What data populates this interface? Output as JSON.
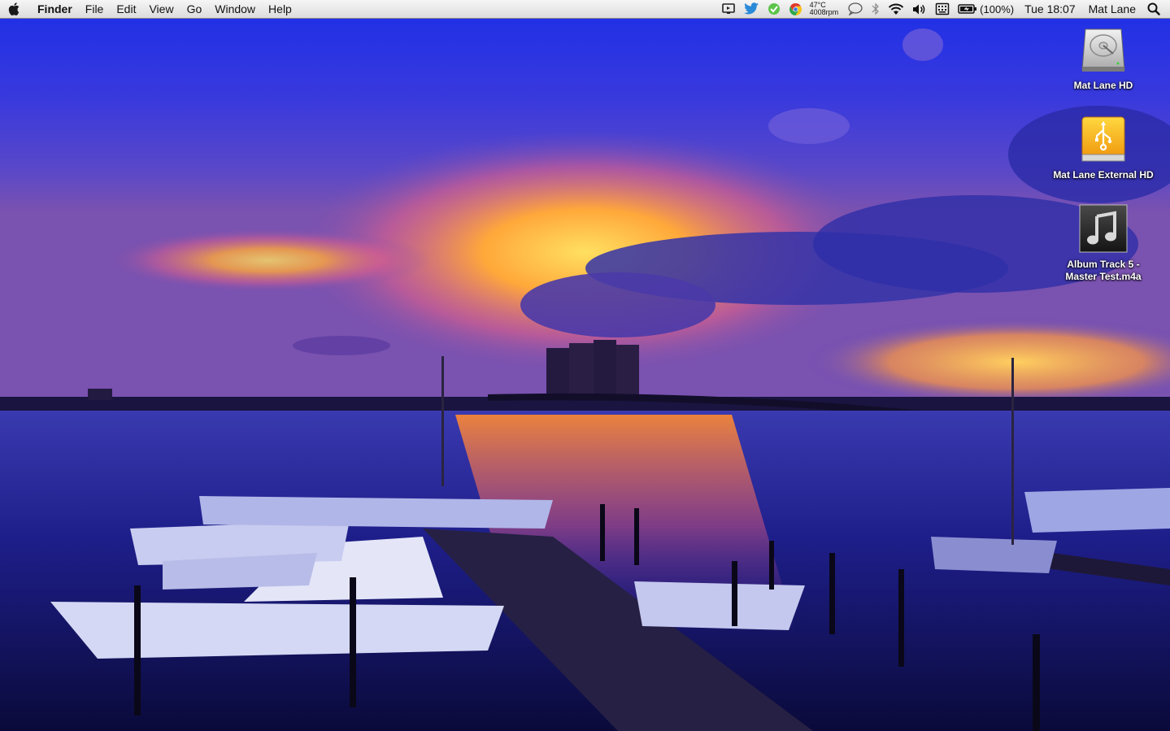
{
  "menubar": {
    "apple_icon": "apple-logo-icon",
    "app_name": "Finder",
    "menus": [
      "File",
      "Edit",
      "View",
      "Go",
      "Window",
      "Help"
    ],
    "status": {
      "temperature": "47°C",
      "fan_speed": "4008rpm",
      "battery_percent": "(100%)",
      "clock": "Tue 18:07",
      "user": "Mat Lane"
    },
    "tray_icons": [
      "display-icon",
      "twitter-bird-icon",
      "evernote-icon",
      "chrome-icon",
      "temperature-monitor",
      "speech-bubble-icon",
      "bluetooth-icon",
      "wifi-icon",
      "volume-icon",
      "keyboard-input-icon",
      "battery-icon",
      "spotlight-search-icon"
    ]
  },
  "desktop": {
    "icons": [
      {
        "name": "Mat Lane HD",
        "icon": "hard-drive-icon"
      },
      {
        "name": "Mat Lane External HD",
        "icon": "usb-drive-icon"
      },
      {
        "name": "Album Track 5 -\nMaster Test.m4a",
        "icon": "music-file-icon"
      }
    ]
  },
  "colors": {
    "menubar_bg": "#e8e8e8",
    "sky_top": "#2a2ae0",
    "sunset_orange": "#ffae3a"
  }
}
